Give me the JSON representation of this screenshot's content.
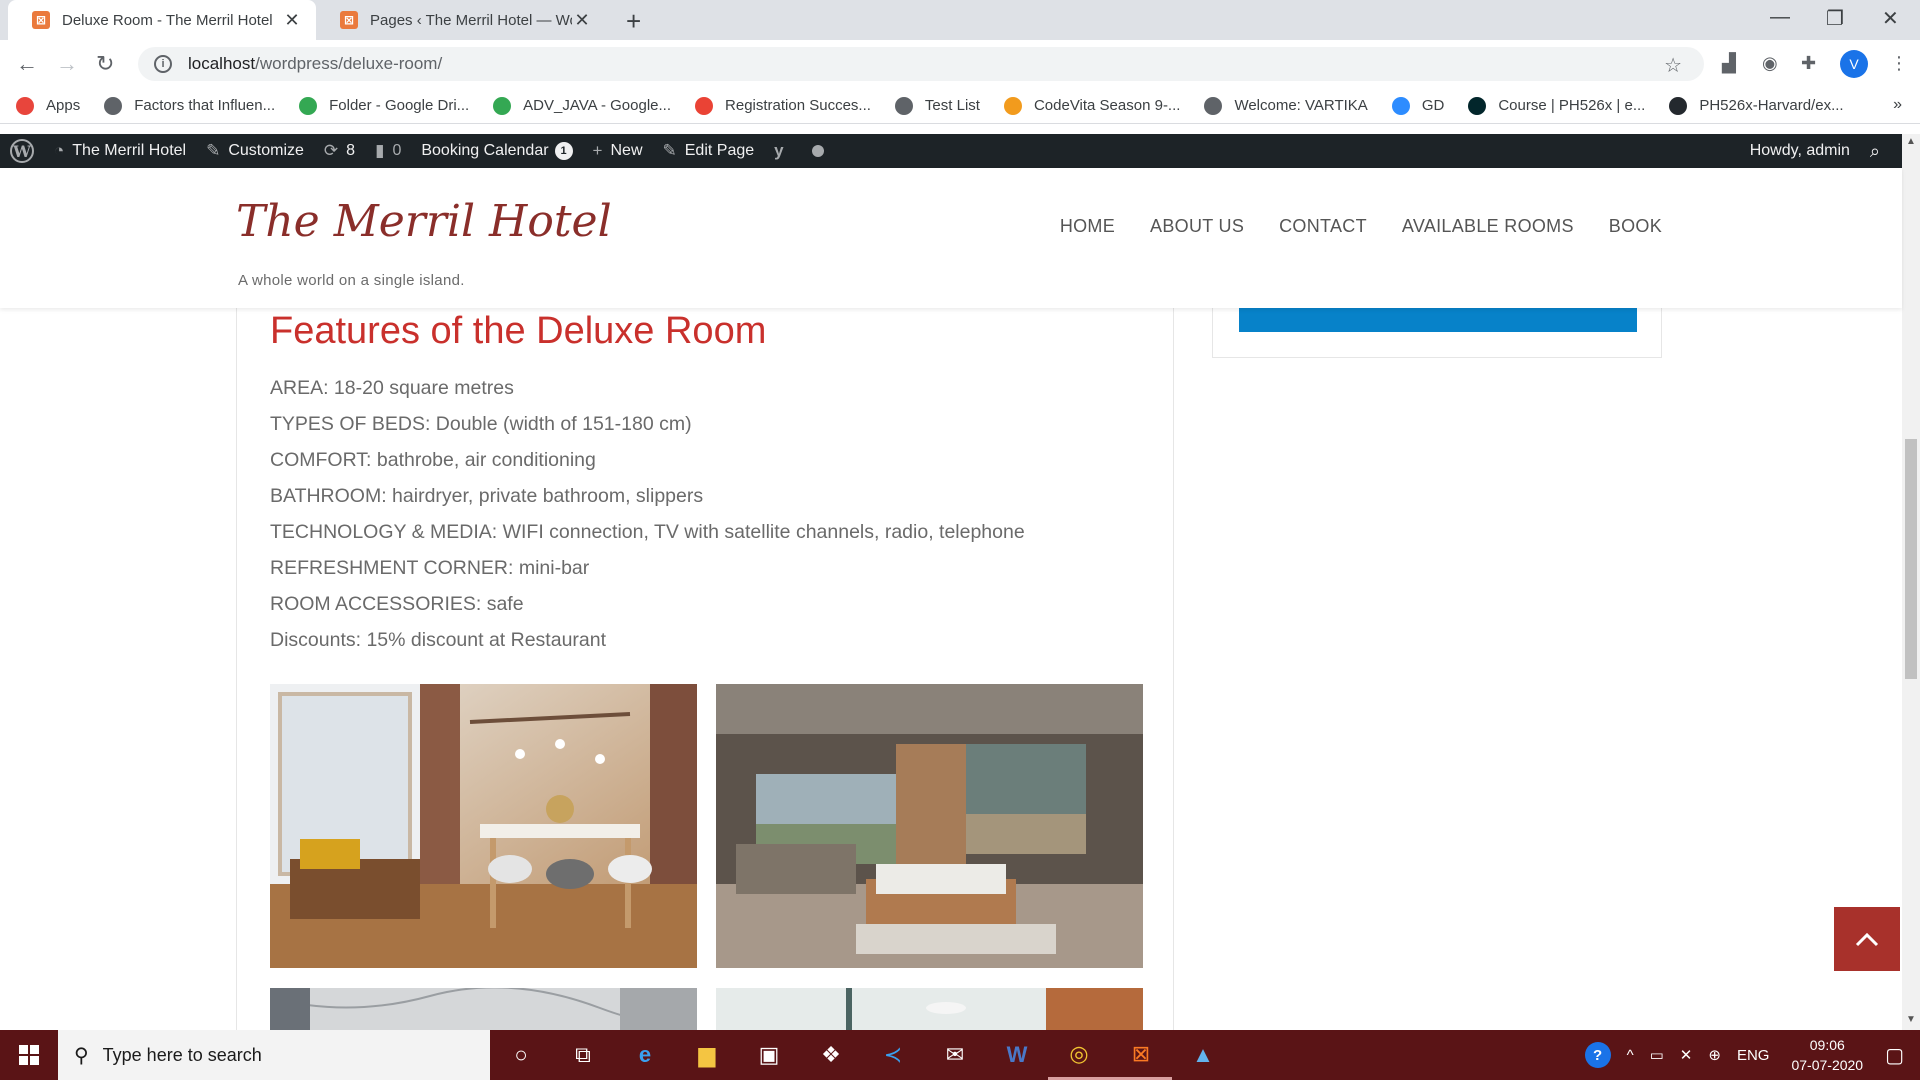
{
  "browser": {
    "tabs": [
      {
        "title": "Deluxe Room - The Merril Hotel",
        "active": true
      },
      {
        "title": "Pages ‹ The Merril Hotel — Word",
        "active": false
      }
    ],
    "url_host": "localhost",
    "url_path": "/wordpress/deluxe-room/",
    "profile_initial": "V",
    "bookmarks": [
      {
        "label": "Apps",
        "icon": "apps-grid-icon",
        "color": "#e8453c"
      },
      {
        "label": "Factors that Influen...",
        "icon": "globe-icon",
        "color": "#5f6368"
      },
      {
        "label": "Folder - Google Dri...",
        "icon": "google-drive-icon",
        "color": "#34a853"
      },
      {
        "label": "ADV_JAVA - Google...",
        "icon": "google-drive-icon",
        "color": "#34a853"
      },
      {
        "label": "Registration Succes...",
        "icon": "gmail-icon",
        "color": "#ea4335"
      },
      {
        "label": "Test List",
        "icon": "globe-icon",
        "color": "#5f6368"
      },
      {
        "label": "CodeVita Season 9-...",
        "icon": "codevita-icon",
        "color": "#f29b1d"
      },
      {
        "label": "Welcome: VARTIKA",
        "icon": "globe-icon",
        "color": "#5f6368"
      },
      {
        "label": "GD",
        "icon": "zoom-icon",
        "color": "#2d8cff"
      },
      {
        "label": "Course | PH526x | e...",
        "icon": "edx-icon",
        "color": "#02262b"
      },
      {
        "label": "PH526x-Harvard/ex...",
        "icon": "github-icon",
        "color": "#24292e"
      }
    ]
  },
  "adminbar": {
    "site_name": "The Merril Hotel",
    "customize": "Customize",
    "updates": "8",
    "comments": "0",
    "booking_calendar": "Booking Calendar",
    "booking_count": "1",
    "new": "New",
    "edit_page": "Edit Page",
    "howdy": "Howdy, admin"
  },
  "site": {
    "title": "The Merril Hotel",
    "tagline": "A whole world on a single island.",
    "nav": [
      "HOME",
      "ABOUT US",
      "CONTACT",
      "AVAILABLE ROOMS",
      "BOOK"
    ]
  },
  "content": {
    "heading": "Features of the Deluxe Room",
    "features": [
      "AREA: 18-20 square metres",
      "TYPES OF BEDS: Double (width of 151-180 cm)",
      "COMFORT: bathrobe, air conditioning",
      "BATHROOM: hairdryer, private bathroom, slippers",
      "TECHNOLOGY & MEDIA: WIFI connection, TV with satellite channels, radio, telephone",
      "REFRESHMENT CORNER: mini-bar",
      "ROOM ACCESSORIES: safe",
      "Discounts: 15% discount at Restaurant"
    ]
  },
  "taskbar": {
    "search_placeholder": "Type here to search",
    "lang": "ENG",
    "time": "09:06",
    "date": "07-07-2020"
  },
  "colors": {
    "site_title": "#8a2e2a",
    "heading": "#c9302c",
    "widget_bar": "#0782c9",
    "back_to_top": "#a8312b",
    "taskbar": "#5a1416"
  }
}
